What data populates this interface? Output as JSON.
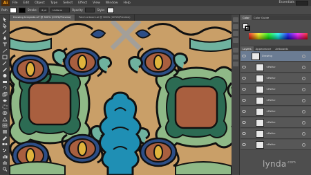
{
  "app": {
    "logo": "Ai"
  },
  "menubar": {
    "items": [
      "File",
      "Edit",
      "Object",
      "Type",
      "Select",
      "Effect",
      "View",
      "Window",
      "Help"
    ],
    "workspace": "Essentials"
  },
  "controlbar": {
    "selection_label": "Path",
    "stroke_label": "Stroke:",
    "stroke_weight": "4 pt",
    "profile": "Uniform",
    "opacity_label": "Opacity:",
    "style_label": "Style:",
    "fill_color": "#ffffff",
    "stroke_color": "#000000"
  },
  "tabs": [
    {
      "label": "Drawing template.ai* @ 300% (CMYK/Preview)",
      "active": true
    },
    {
      "label": "Patch artwork.ai @ 300% (CMYK/Preview)",
      "active": false
    }
  ],
  "color_panel": {
    "tabs": [
      "Color",
      "Color Guide"
    ]
  },
  "layers_panel": {
    "tabs": [
      "Layers",
      "Appearance",
      "Artboards"
    ],
    "rows": [
      {
        "name": "Drawing",
        "top": true
      },
      {
        "name": "<Path>",
        "top": false
      },
      {
        "name": "<Path>",
        "top": false
      },
      {
        "name": "<Path>",
        "top": false
      },
      {
        "name": "<Path>",
        "top": false
      },
      {
        "name": "<Path>",
        "top": false
      },
      {
        "name": "<Path>",
        "top": false
      },
      {
        "name": "<Path>",
        "top": false
      },
      {
        "name": "<Path>",
        "top": false
      }
    ]
  },
  "artwork_colors": {
    "background": "#c99f68",
    "green": "#8fb987",
    "teal": "#6fb29f",
    "blue": "#1f8fb4",
    "navy": "#2d4e86",
    "brown": "#a95f3f",
    "gold": "#e0b33c",
    "dark_green": "#2c6b53",
    "outline": "#111111"
  },
  "watermark": {
    "text": "lynda",
    "suffix": ".com"
  }
}
